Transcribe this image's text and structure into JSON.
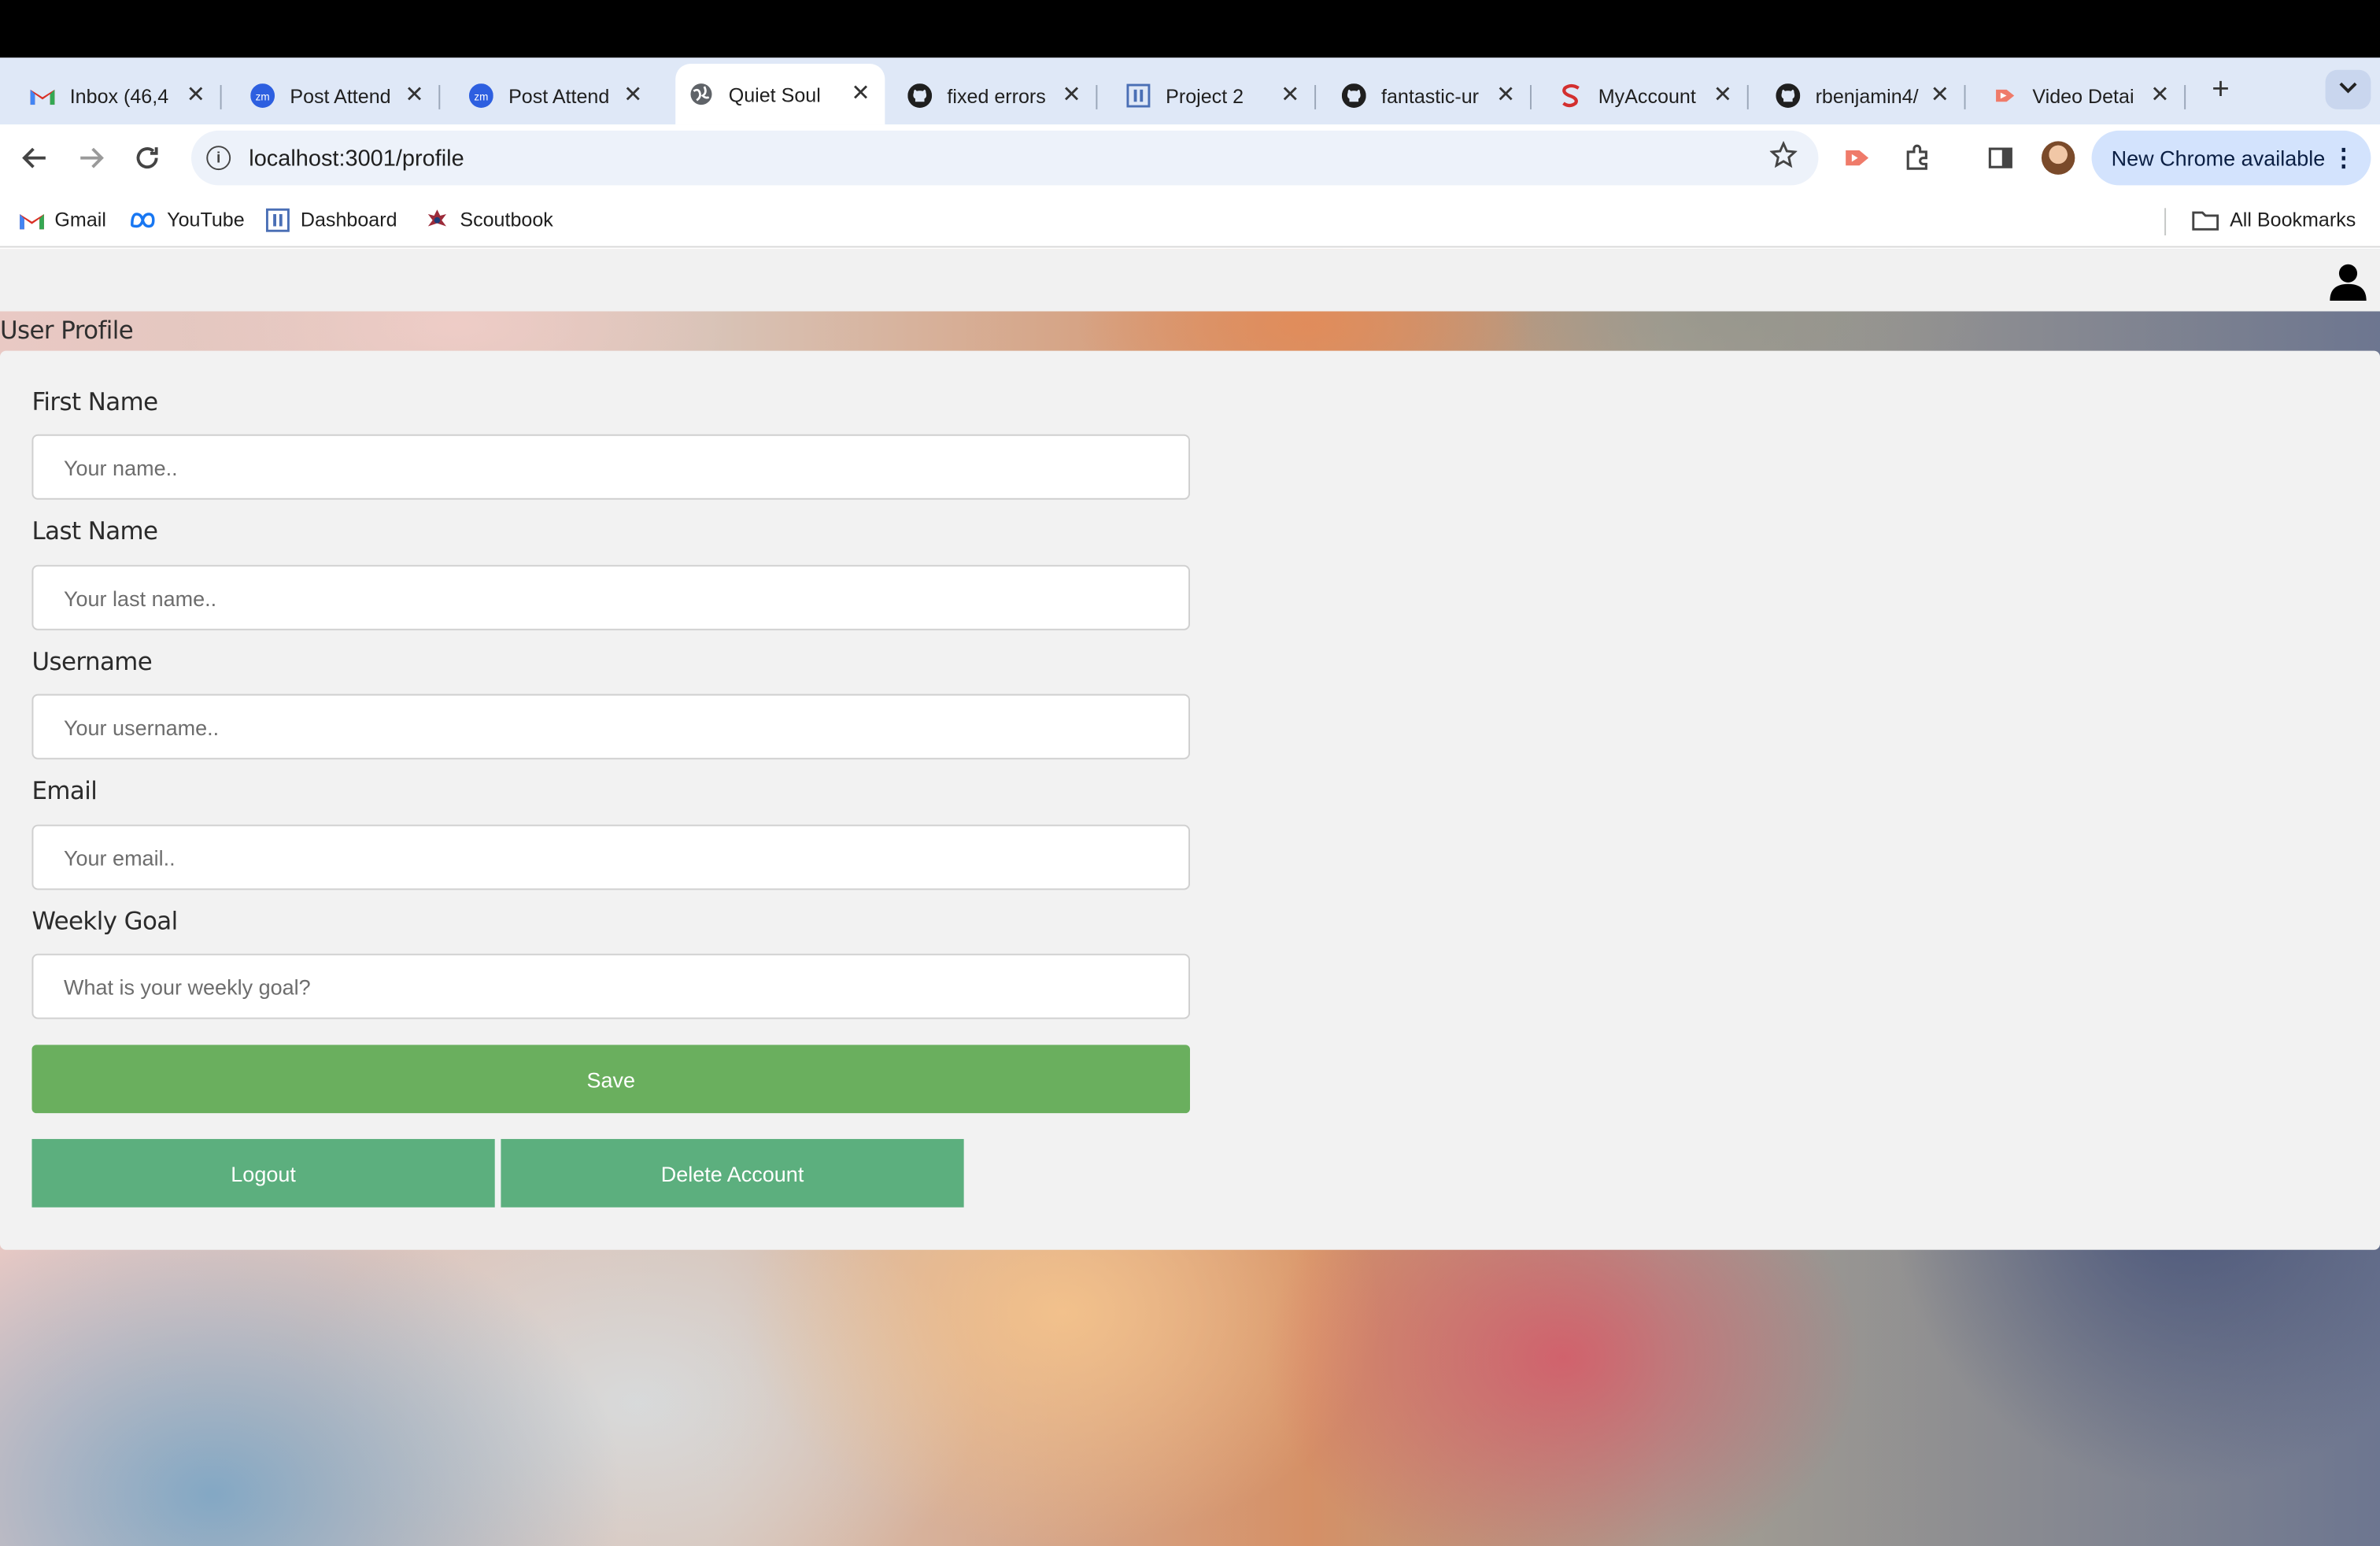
{
  "browser": {
    "tabs": [
      {
        "title": "Inbox (46,4",
        "icon": "gmail-icon"
      },
      {
        "title": "Post Attend",
        "icon": "zoom-icon"
      },
      {
        "title": "Post Attend",
        "icon": "zoom-icon"
      },
      {
        "title": "Quiet Soul",
        "icon": "globe-icon",
        "active": true
      },
      {
        "title": "fixed errors",
        "icon": "github-icon"
      },
      {
        "title": "Project 2",
        "icon": "docs-icon"
      },
      {
        "title": "fantastic-ur",
        "icon": "github-icon"
      },
      {
        "title": "MyAccount",
        "icon": "s-logo-icon"
      },
      {
        "title": "rbenjamin4/",
        "icon": "github-icon"
      },
      {
        "title": "Video Detai",
        "icon": "video-icon"
      }
    ],
    "tab_close_glyph": "✕",
    "new_tab_glyph": "+",
    "url": "localhost:3001/profile",
    "update_button": "New Chrome available",
    "bookmarks": [
      {
        "label": "Gmail"
      },
      {
        "label": "YouTube"
      },
      {
        "label": "Dashboard"
      },
      {
        "label": "Scoutbook"
      }
    ],
    "all_bookmarks": "All Bookmarks"
  },
  "page": {
    "heading": "User Profile",
    "fields": [
      {
        "label": "First Name",
        "placeholder": "Your name..",
        "value": ""
      },
      {
        "label": "Last Name",
        "placeholder": "Your last name..",
        "value": ""
      },
      {
        "label": "Username",
        "placeholder": "Your username..",
        "value": ""
      },
      {
        "label": "Email",
        "placeholder": "Your email..",
        "value": ""
      },
      {
        "label": "Weekly Goal",
        "placeholder": "What is your weekly goal?",
        "value": ""
      }
    ],
    "save_label": "Save",
    "logout_label": "Logout",
    "delete_label": "Delete Account"
  },
  "colors": {
    "save_button": "#6aaf5e",
    "secondary_buttons": "#5caf7e",
    "tab_strip": "#dfe8f7",
    "update_pill": "#d3e3fd"
  }
}
